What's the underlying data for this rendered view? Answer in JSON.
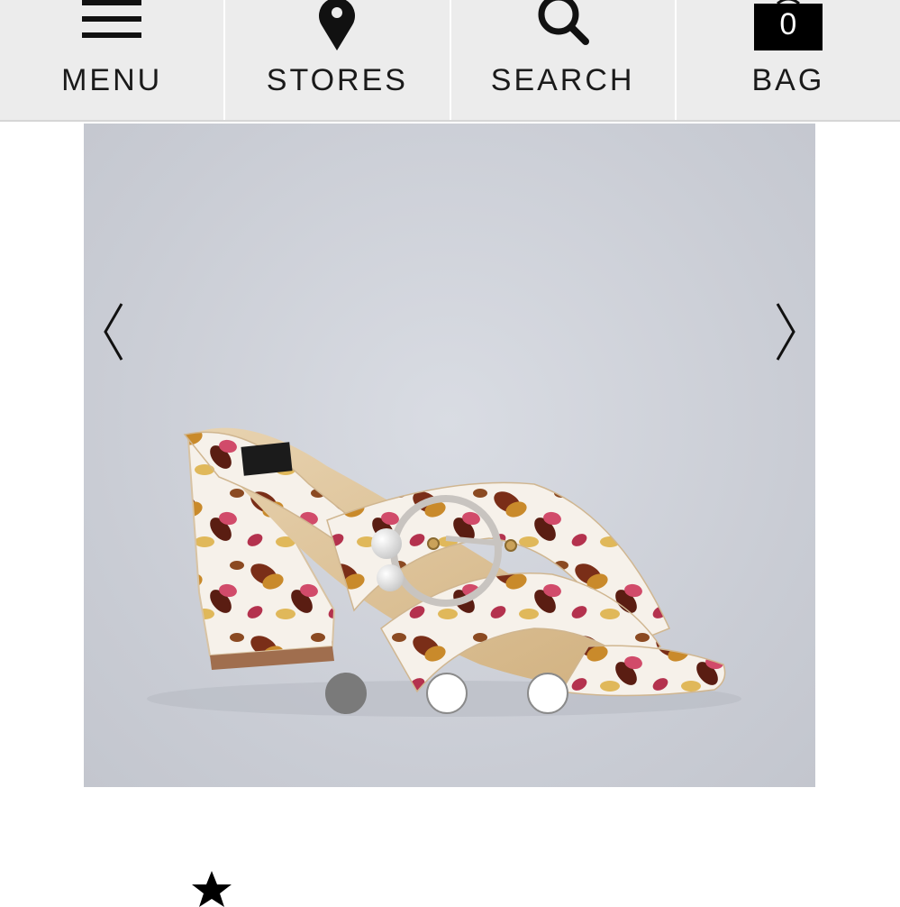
{
  "nav": {
    "items": [
      {
        "label": "MENU",
        "icon": "hamburger-menu-icon"
      },
      {
        "label": "STORES",
        "icon": "map-pin-icon"
      },
      {
        "label": "SEARCH",
        "icon": "search-icon"
      },
      {
        "label": "BAG",
        "icon": "shopping-bag-icon"
      }
    ],
    "bag_count": "0"
  },
  "gallery": {
    "prev_icon": "chevron-left-icon",
    "next_icon": "chevron-right-icon",
    "product_image": "floral-print-buckle-block-heel-mule-sandal",
    "dots": [
      {
        "state": "active"
      },
      {
        "state": "inactive"
      },
      {
        "state": "inactive"
      }
    ],
    "current_slide": 1,
    "total_slides": 3
  },
  "rating": {
    "icon": "star-icon"
  },
  "colors": {
    "nav_background": "#ececec",
    "text": "#1a1a1a",
    "gallery_background": "#cdd0d8",
    "dot_active": "#7a7a7a",
    "dot_inactive": "#ffffff"
  }
}
